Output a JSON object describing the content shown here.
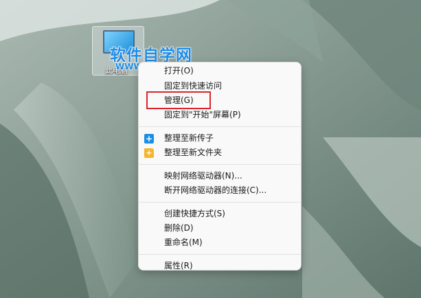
{
  "desktop_icon": {
    "label": "此电脑"
  },
  "watermark": {
    "title": "软件自学网",
    "url": "WWW.RJZXW.COM"
  },
  "context_menu": {
    "groups": [
      [
        {
          "label": "打开(O)",
          "icon": null
        },
        {
          "label": "固定到快速访问",
          "icon": null
        },
        {
          "label": "管理(G)",
          "icon": null,
          "highlighted": true
        },
        {
          "label": "固定到\"开始\"屏幕(P)",
          "icon": null
        }
      ],
      [
        {
          "label": "整理至新传子",
          "icon": "blue-plus-icon"
        },
        {
          "label": "整理至新文件夹",
          "icon": "folder-plus-icon"
        }
      ],
      [
        {
          "label": "映射网络驱动器(N)...",
          "icon": null
        },
        {
          "label": "断开网络驱动器的连接(C)...",
          "icon": null
        }
      ],
      [
        {
          "label": "创建快捷方式(S)",
          "icon": null
        },
        {
          "label": "删除(D)",
          "icon": null
        },
        {
          "label": "重命名(M)",
          "icon": null
        }
      ],
      [
        {
          "label": "属性(R)",
          "icon": null
        }
      ]
    ]
  },
  "colors": {
    "accent_blue": "#1b8fe4",
    "folder_yellow": "#f5b62a",
    "highlight_red": "#d6262b"
  }
}
